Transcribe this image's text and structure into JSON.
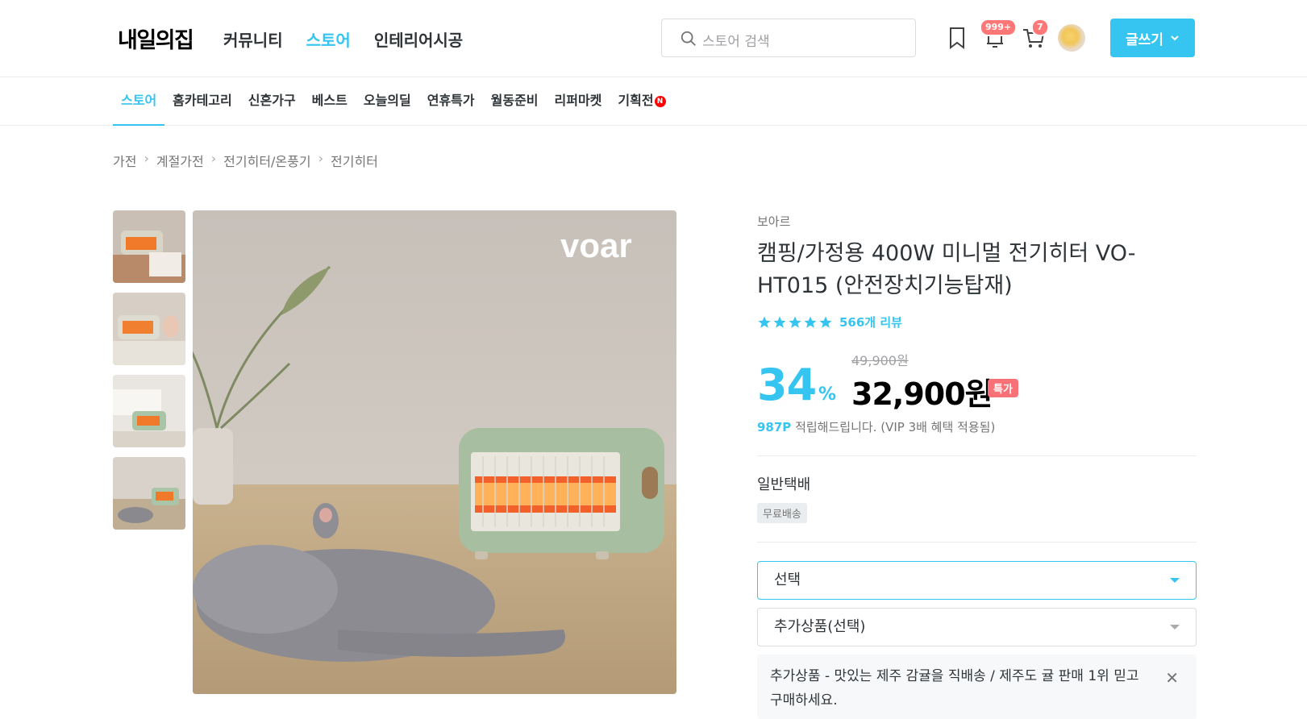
{
  "header": {
    "logo": "내일의집",
    "nav": [
      {
        "label": "커뮤니티",
        "active": false
      },
      {
        "label": "스토어",
        "active": true
      },
      {
        "label": "인테리어시공",
        "active": false
      }
    ],
    "search_placeholder": "스토어 검색",
    "notification_count": "999+",
    "cart_count": "7",
    "write_label": "글쓰기"
  },
  "subnav": [
    {
      "label": "스토어",
      "active": true
    },
    {
      "label": "홈카테고리",
      "active": false
    },
    {
      "label": "신혼가구",
      "active": false
    },
    {
      "label": "베스트",
      "active": false
    },
    {
      "label": "오늘의딜",
      "active": false
    },
    {
      "label": "연휴특가",
      "active": false
    },
    {
      "label": "월동준비",
      "active": false
    },
    {
      "label": "리퍼마켓",
      "active": false
    },
    {
      "label": "기획전",
      "active": false,
      "new": "N"
    }
  ],
  "breadcrumb": [
    "가전",
    "계절가전",
    "전기히터/온풍기",
    "전기히터"
  ],
  "product": {
    "brand_logo": "voar",
    "brand": "보아르",
    "title": "캠핑/가정용 400W 미니멀 전기히터 VO-HT015 (안전장치기능탑재)",
    "rating": 5,
    "reviews": "566개 리뷰",
    "original_price": "49,900원",
    "discount": "34",
    "discount_unit": "%",
    "price": "32,900원",
    "special_badge": "특가",
    "points_value": "987P",
    "points_text": " 적립해드립니다. (VIP 3배 혜택 적용됨)",
    "shipping_label": "일반택배",
    "shipping_badge": "무료배송",
    "select_label": "선택",
    "addon_select_label": "추가상품(선택)",
    "addon_item": "추가상품 - 맛있는 제주 감귤을 직배송 / 제주도 귤 판매 1위 믿고 구매하세요."
  },
  "colors": {
    "accent": "#35c5f0",
    "special": "#f77176",
    "badge": "#f77"
  }
}
